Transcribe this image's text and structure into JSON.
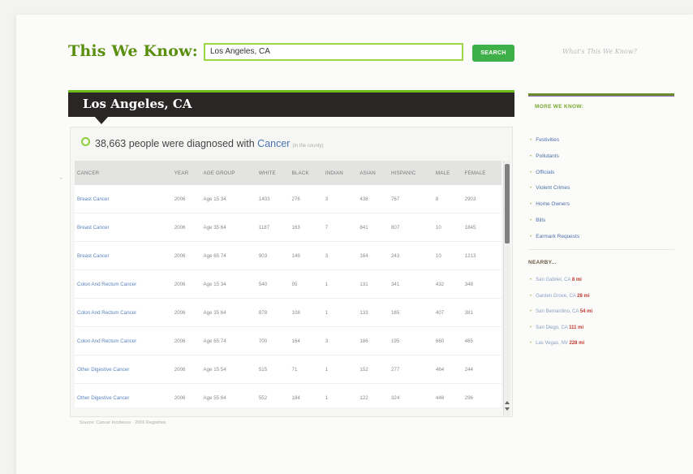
{
  "header": {
    "brand": "This We Know:",
    "search_value": "Los Angeles, CA",
    "search_button": "SEARCH",
    "whats_link": "What's This We Know?"
  },
  "location": {
    "title": "Los Angeles, CA"
  },
  "summary": {
    "count_text": "38,663 people were diagnosed with",
    "topic_link": "Cancer",
    "note": "(in the county)"
  },
  "table": {
    "columns": [
      "CANCER",
      "YEAR",
      "AGE GROUP",
      "WHITE",
      "BLACK",
      "INDIAN",
      "ASIAN",
      "HISPANIC",
      "MALE",
      "FEMALE"
    ],
    "rows": [
      [
        "Breast Cancer",
        "2006",
        "Age 15 34",
        "1403",
        "276",
        "3",
        "438",
        "767",
        "8",
        "2903"
      ],
      [
        "Breast Cancer",
        "2006",
        "Age 35 64",
        "1187",
        "163",
        "7",
        "841",
        "807",
        "10",
        "1845"
      ],
      [
        "Breast Cancer",
        "2006",
        "Age 65 74",
        "903",
        "149",
        "3",
        "164",
        "243",
        "10",
        "1213"
      ],
      [
        "Colon And Rectum Cancer",
        "2006",
        "Age 15 34",
        "540",
        "95",
        "1",
        "131",
        "341",
        "432",
        "348"
      ],
      [
        "Colon And Rectum Cancer",
        "2006",
        "Age 35 64",
        "878",
        "108",
        "1",
        "133",
        "165",
        "407",
        "381"
      ],
      [
        "Colon And Rectum Cancer",
        "2006",
        "Age 65 74",
        "700",
        "164",
        "3",
        "186",
        "195",
        "660",
        "465"
      ],
      [
        "Other Digestive Cancer",
        "2006",
        "Age 15 54",
        "515",
        "71",
        "1",
        "152",
        "277",
        "464",
        "244"
      ],
      [
        "Other Digestive Cancer",
        "2006",
        "Age 55 64",
        "552",
        "184",
        "1",
        "122",
        "324",
        "446",
        "296"
      ]
    ]
  },
  "source_note": "Source: Cancer Incidence · 2006 Registries",
  "sidebar": {
    "more_title": "MORE WE KNOW:",
    "items": [
      "Festivities",
      "Pollutants",
      "Officials",
      "Violent Crimes",
      "Home Owners",
      "Bills",
      "Earmark Requests"
    ],
    "nearby_title": "NEARBY...",
    "nearby": [
      {
        "place": "San Gabriel, CA",
        "dist": "8 mi"
      },
      {
        "place": "Garden Grove, CA",
        "dist": "28 mi"
      },
      {
        "place": "San Bernardino, CA",
        "dist": "54 mi"
      },
      {
        "place": "San Diego, CA",
        "dist": "111 mi"
      },
      {
        "place": "Las Vegas, NV",
        "dist": "228 mi"
      }
    ]
  },
  "colors": {
    "brand_green": "#5a8f10",
    "accent_green": "#3fb047",
    "city_bar": "#2b2626",
    "link_blue": "#4a75b0",
    "distance_red": "#c03a2f"
  }
}
